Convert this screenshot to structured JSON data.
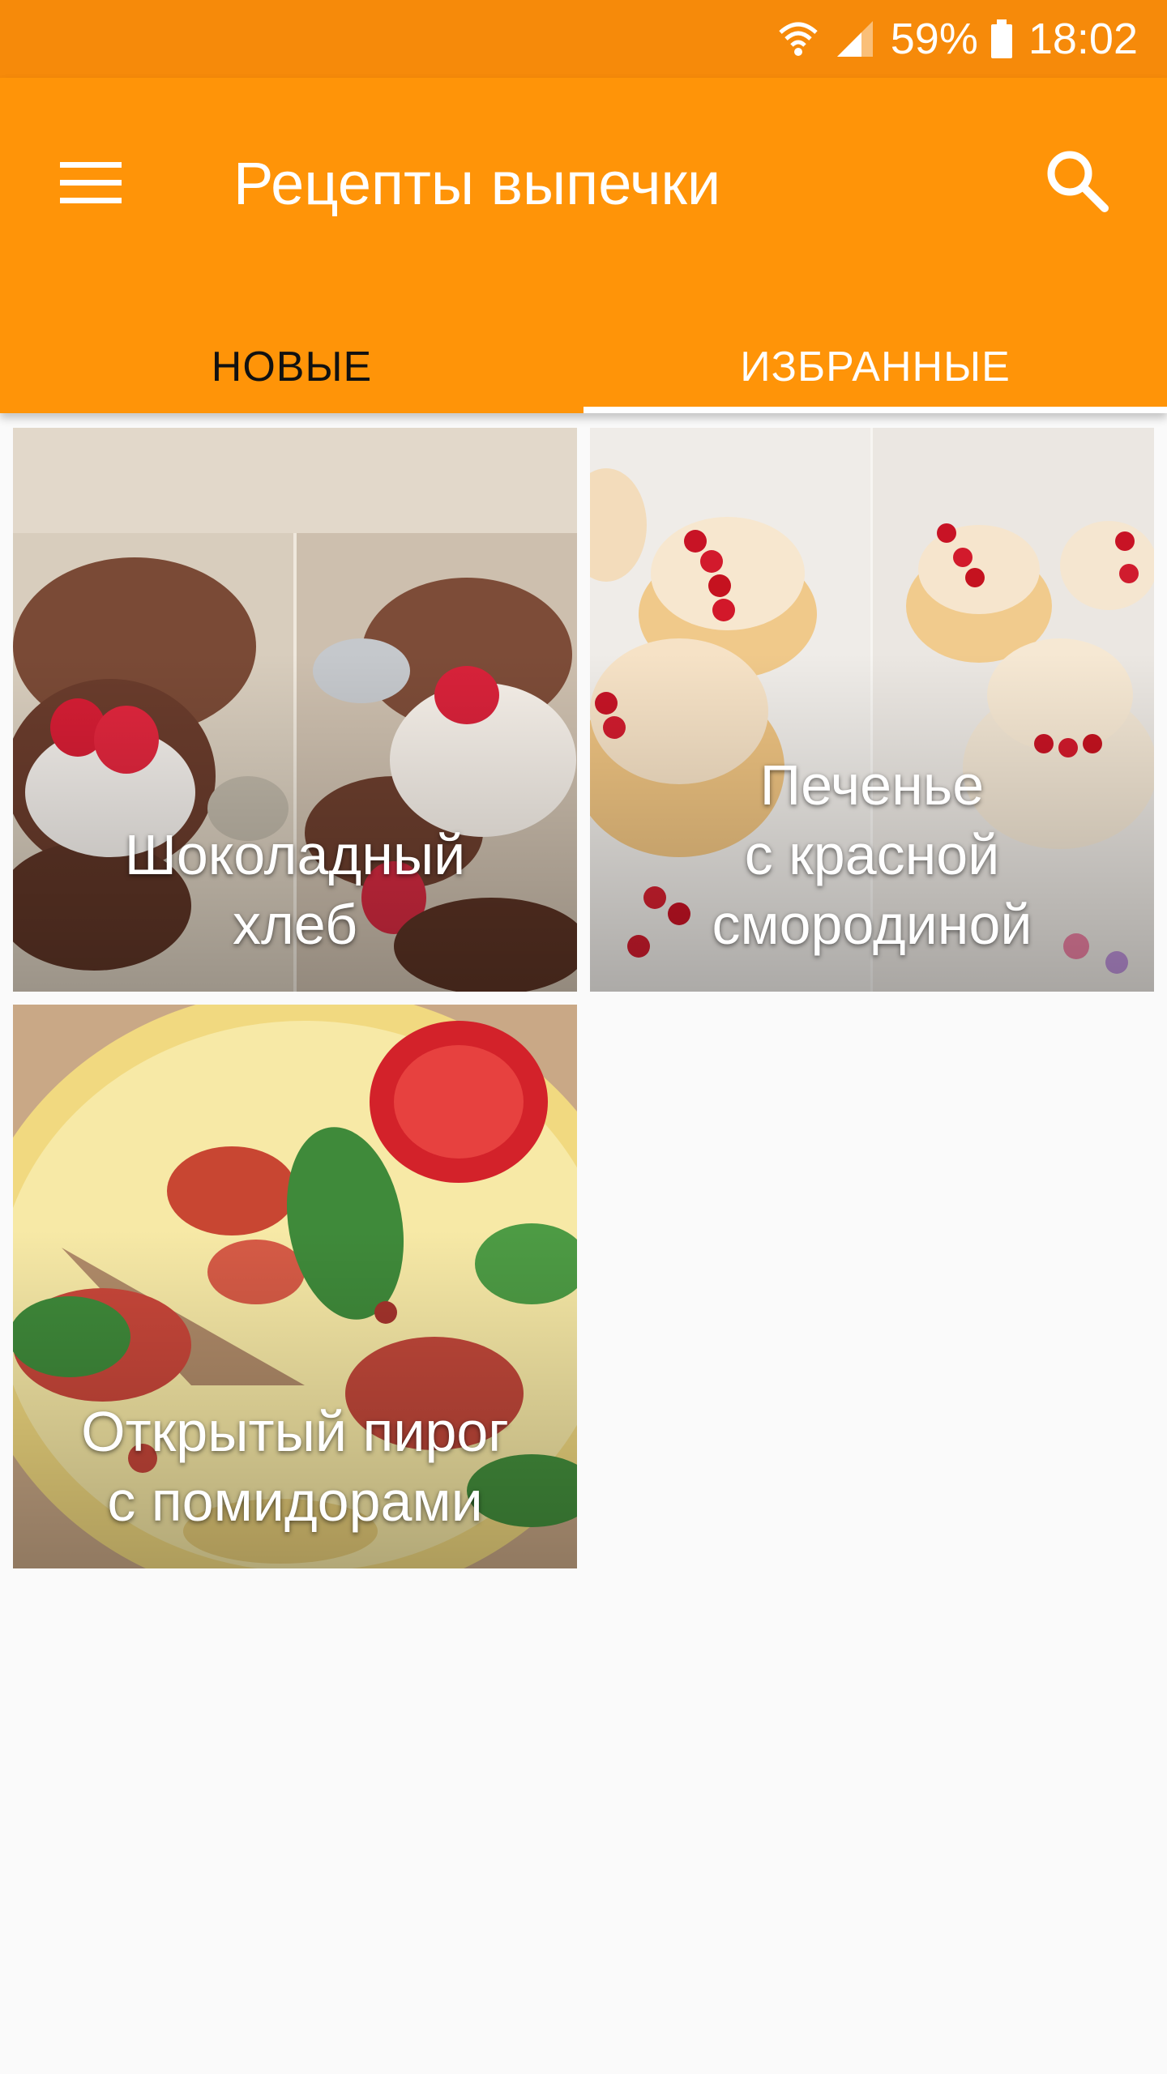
{
  "status_bar": {
    "battery_percent": "59%",
    "time": "18:02",
    "icons": [
      "wifi-icon",
      "signal-icon",
      "battery-icon"
    ]
  },
  "app_bar": {
    "title": "Рецепты выпечки",
    "menu_icon": "menu-icon",
    "search_icon": "search-icon",
    "background_color": "#ff9408",
    "status_color": "#f68a0a"
  },
  "tabs": [
    {
      "label": "НОВЫЕ",
      "active": false
    },
    {
      "label": "ИЗБРАННЫЕ",
      "active": true
    }
  ],
  "recipes": [
    {
      "title": "Шоколадный\nхлеб"
    },
    {
      "title": "Печенье\nс красной\nсмородиной"
    },
    {
      "title": "Открытый пирог\nс помидорами"
    }
  ]
}
